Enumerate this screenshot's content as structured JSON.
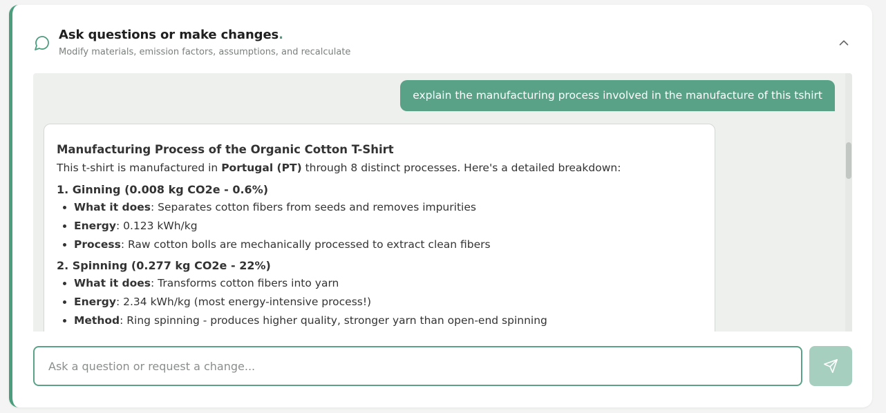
{
  "header": {
    "title": "Ask questions or make changes",
    "title_dot": ".",
    "subtitle": "Modify materials, emission factors, assumptions, and recalculate",
    "icons": {
      "chat": "chat-bubble-icon",
      "collapse": "chevron-up-icon"
    }
  },
  "messages": {
    "user": "explain the manufacturing process involved in the manufacture of this tshirt",
    "assistant": {
      "heading": "Manufacturing Process of the Organic Cotton T-Shirt",
      "intro_before": "This t-shirt is manufactured in ",
      "intro_bold": "Portugal (PT)",
      "intro_after": " through 8 distinct processes. Here's a detailed breakdown:",
      "sections": [
        {
          "title": "1. Ginning (0.008 kg CO2e - 0.6%)",
          "items": [
            {
              "label": "What it does",
              "text": ": Separates cotton fibers from seeds and removes impurities"
            },
            {
              "label": "Energy",
              "text": ": 0.123 kWh/kg"
            },
            {
              "label": "Process",
              "text": ": Raw cotton bolls are mechanically processed to extract clean fibers"
            }
          ]
        },
        {
          "title": "2. Spinning (0.277 kg CO2e - 22%)",
          "items": [
            {
              "label": "What it does",
              "text": ": Transforms cotton fibers into yarn"
            },
            {
              "label": "Energy",
              "text": ": 2.34 kWh/kg (most energy-intensive process!)"
            },
            {
              "label": "Method",
              "text": ": Ring spinning - produces higher quality, stronger yarn than open-end spinning"
            }
          ]
        }
      ]
    }
  },
  "composer": {
    "placeholder": "Ask a question or request a change...",
    "value": "",
    "send_icon": "send-paper-plane-icon"
  },
  "colors": {
    "accent": "#4c9d7e",
    "user_bubble": "#5aa287",
    "send_button": "#a7cfbf"
  }
}
